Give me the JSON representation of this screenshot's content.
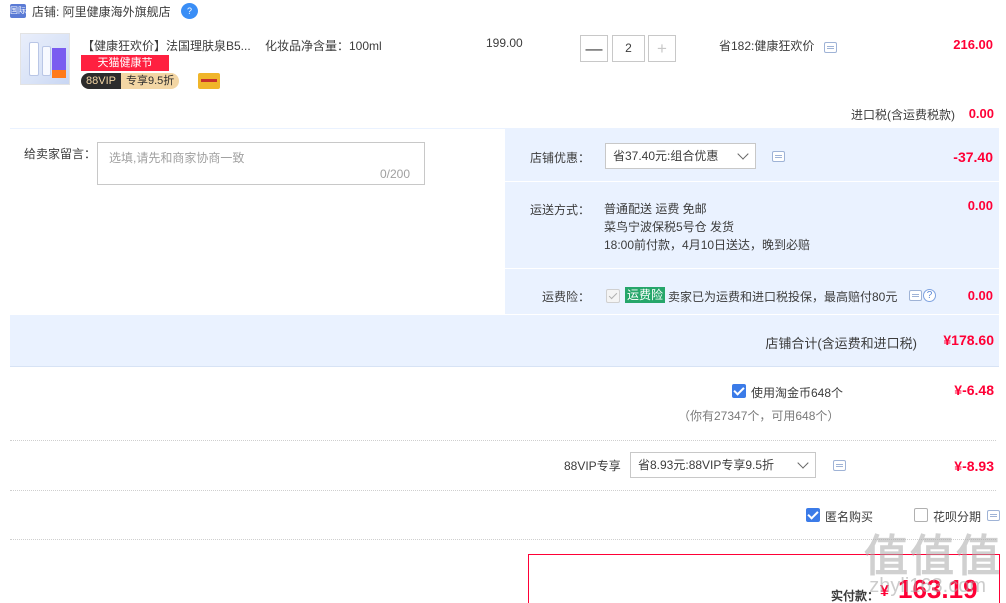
{
  "shop": {
    "tag": "国际",
    "label": "店铺: 阿里健康海外旗舰店",
    "bubble": "?"
  },
  "item": {
    "title": "【健康狂欢价】法国理肤泉B5...",
    "promo_badge": "天猫健康节",
    "vip_a": "88VIP",
    "vip_b": "专享9.5折",
    "spec": "化妆品净含量：100ml",
    "price": "199.00",
    "qty_minus": "—",
    "qty": "2",
    "qty_plus": "+",
    "save_text": "省182:健康狂欢价",
    "total": "216.00"
  },
  "import_tax": {
    "label": "进口税(含运费税款)",
    "value": "0.00"
  },
  "memo": {
    "label": "给卖家留言：",
    "placeholder": "选填,请先和商家协商一致",
    "count": "0/200"
  },
  "discount": {
    "label": "店铺优惠：",
    "selected": "省37.40元:组合优惠",
    "value": "-37.40"
  },
  "shipping": {
    "label": "运送方式：",
    "line1": "普通配送 运费 免邮",
    "line2": "菜鸟宁波保税5号仓   发货",
    "line3": "18:00前付款，4月10日送达，晚到必赔",
    "value": "0.00"
  },
  "insurance": {
    "label": "运费险：",
    "tag": "运费险",
    "text": "卖家已为运费和进口税投保，最高赔付80元",
    "help": "?",
    "value": "0.00"
  },
  "subtotal": {
    "label": "店铺合计(含运费和进口税)",
    "value": "¥178.60"
  },
  "coins": {
    "label": "使用淘金币648个",
    "sub": "（你有27347个，可用648个）",
    "value": "¥-6.48"
  },
  "vip": {
    "label": "88VIP专享",
    "selected": "省8.93元:88VIP专享9.5折",
    "value": "¥-8.93"
  },
  "options": {
    "anonymous": "匿名购买",
    "installment": "花呗分期"
  },
  "pay": {
    "label": "实付款：",
    "currency": "¥",
    "value": "163.19"
  },
  "watermark": {
    "main": "值值值",
    "sub": "zhyli163.com"
  },
  "colors": {
    "accent_red": "#ff0036",
    "panel_blue": "#eaf2ff",
    "check_blue": "#3b7be8",
    "insurance_green": "#26a66a"
  }
}
